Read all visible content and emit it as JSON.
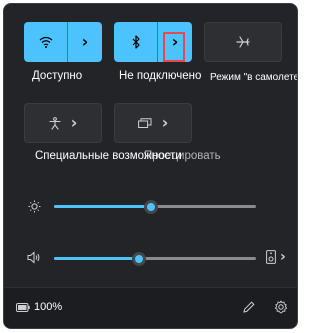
{
  "tiles": {
    "wifi": {
      "label": "Доступно",
      "icon": "wifi-icon",
      "state": "on"
    },
    "bluetooth": {
      "label": "Не подключено",
      "icon": "bluetooth-icon",
      "state": "on"
    },
    "airplane": {
      "label": "Режим \"в самолете\"",
      "icon": "airplane-icon",
      "state": "off"
    },
    "accessibility": {
      "label": "Специальные возможности",
      "icon": "accessibility-icon",
      "state": "off"
    },
    "project": {
      "label": "Проецировать",
      "icon": "project-icon",
      "state": "off"
    }
  },
  "sliders": {
    "brightness": {
      "icon": "brightness-icon",
      "value_percent": 48
    },
    "volume": {
      "icon": "speaker-icon",
      "value_percent": 42,
      "output_icon": "speaker-device-icon"
    }
  },
  "footer": {
    "battery_percent": "100%",
    "battery_icon": "battery-icon",
    "edit_icon": "pencil-icon",
    "settings_icon": "gear-icon"
  },
  "colors": {
    "accent": "#4cc2ff",
    "panel": "#222428",
    "highlight": "#e8494e"
  }
}
